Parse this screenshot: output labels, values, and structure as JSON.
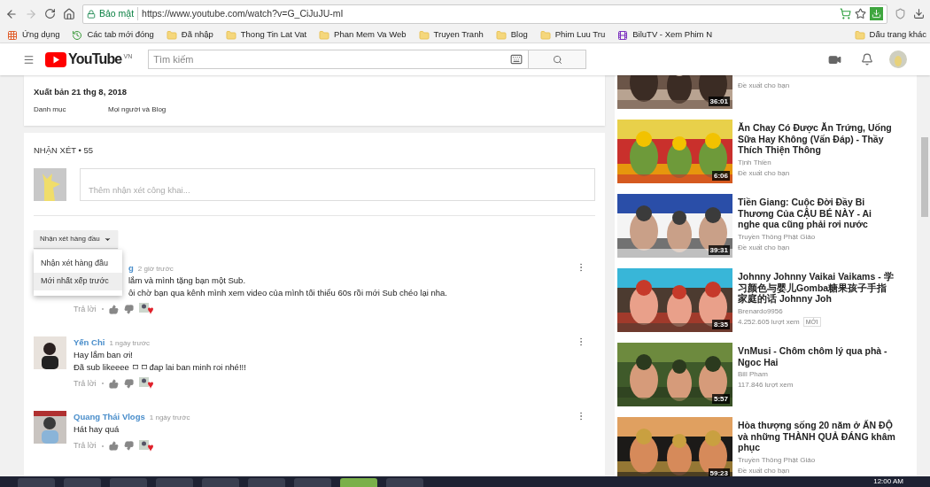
{
  "browser": {
    "security_label": "Bảo mật",
    "url": "https://www.youtube.com/watch?v=G_CiJuJU-mI",
    "bookmarks": [
      {
        "label": "Ứng dụng",
        "kind": "apps"
      },
      {
        "label": "Các tab mới đóng",
        "kind": "history"
      },
      {
        "label": "Đã nhập",
        "kind": "folder"
      },
      {
        "label": "Thong Tin Lat Vat",
        "kind": "folder"
      },
      {
        "label": "Phan Mem Va Web",
        "kind": "folder"
      },
      {
        "label": "Truyen Tranh",
        "kind": "folder"
      },
      {
        "label": "Blog",
        "kind": "folder"
      },
      {
        "label": "Phim Luu Tru",
        "kind": "folder"
      },
      {
        "label": "BiluTV - Xem Phim N",
        "kind": "site"
      }
    ],
    "other_bookmarks": "Dấu trang khác"
  },
  "header": {
    "logo": "YouTube",
    "region": "VN",
    "search_placeholder": "Tìm kiếm"
  },
  "description": {
    "published": "Xuất bản 21 thg 8, 2018",
    "category_label": "Danh mục",
    "category": "Mọi người và Blog"
  },
  "comments": {
    "title": "NHẬN XÉT • 55",
    "input_placeholder": "Thêm nhận xét công khai...",
    "sort_button": "Nhận xét hàng đầu",
    "sort_menu": [
      {
        "label": "Nhận xét hàng đầu",
        "selected": false
      },
      {
        "label": "Mới nhất xếp trước",
        "selected": true
      }
    ],
    "items": [
      {
        "kind": "covered",
        "author": "g",
        "time": "2 giờ trước",
        "lines": [
          "lắm và mình tặng bạn một Sub.",
          "ôi chờ bạn qua kênh mình xem video của mình tối thiểu 60s rồi mới Sub chéo lại nha."
        ],
        "reply": "Trả lời"
      },
      {
        "kind": "full",
        "author": "Yến Chi",
        "time": "1 ngày trước",
        "lines": [
          "Hay lắm ban ơi!",
          "Đã sub likeeee ㅁㅁđap lai ban minh roi nhé!!!"
        ],
        "reply": "Trả lời"
      },
      {
        "kind": "full",
        "author": "Quang Thái Vlogs",
        "time": "1 ngày trước",
        "lines": [
          "Hát hay quá"
        ],
        "reply": "Trả lời"
      }
    ]
  },
  "related": [
    {
      "kind": "cut",
      "meta": "Đề xuất cho bạn",
      "duration": "36:01"
    },
    {
      "kind": "full",
      "title": "Ăn Chay Có Được Ăn Trứng, Uống Sữa Hay Không (Vấn Đáp) - Thầy Thích Thiện Thông",
      "channel": "Tịnh Thiền",
      "meta": "Đề xuất cho bạn",
      "duration": "6:06"
    },
    {
      "kind": "full",
      "title": "Tiền Giang: Cuộc Đời Đầy Bi Thương Của CẬU BÉ NÀY - Ai nghe qua cũng phải rơi nước",
      "channel": "Truyền Thông Phật Giáo",
      "meta": "Đề xuất cho bạn",
      "duration": "39:31"
    },
    {
      "kind": "full",
      "title": "Johnny Johnny Vaikai Vaikams - 学习颜色与婴儿Gomba糖果孩子手指家庭的话 Johnny Joh",
      "channel": "Brenardo9956",
      "meta": "4.252.605 lượt xem",
      "badge": "MỚI",
      "duration": "8:35"
    },
    {
      "kind": "full",
      "title": "VnMusi - Chôm chôm lý qua phà - Ngoc Hai",
      "channel": "Bill Pham",
      "meta": "117.846 lượt xem",
      "duration": "5:57"
    },
    {
      "kind": "full",
      "title": "Hòa thượng sống 20 năm ở ẤN ĐỘ và những THÀNH QUẢ ĐÁNG khâm phục",
      "channel": "Truyền Thông Phật Giáo",
      "meta": "Đề xuất cho bạn",
      "duration": "59:23"
    }
  ],
  "taskbar": {
    "clock": "12:00 AM"
  }
}
